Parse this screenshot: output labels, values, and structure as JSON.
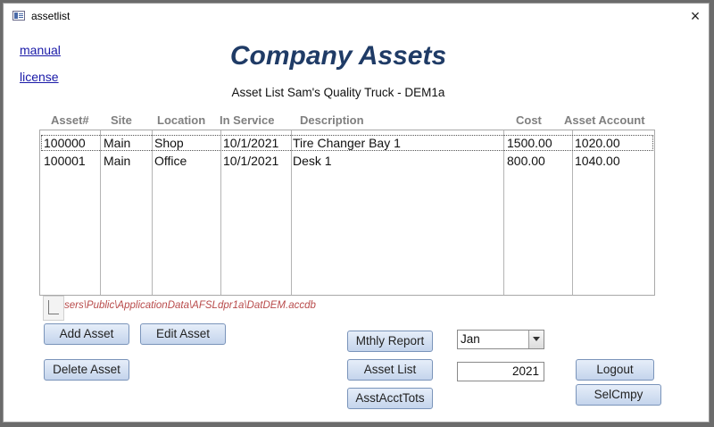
{
  "window": {
    "title": "assetlist",
    "close_glyph": "×"
  },
  "links": {
    "manual": "manual",
    "license": "license"
  },
  "header": {
    "title": "Company Assets",
    "subtitle": "Asset List Sam's Quality Truck - DEM1a"
  },
  "table": {
    "columns": [
      "Asset#",
      "Site",
      "Location",
      "In Service",
      "Description",
      "Cost",
      "Asset Account"
    ],
    "rows": [
      {
        "asset": "100000",
        "site": "Main",
        "location": "Shop",
        "in_service": "10/1/2021",
        "description": "Tire Changer Bay 1",
        "cost": "1500.00",
        "account": "1020.00",
        "selected": true
      },
      {
        "asset": "100001",
        "site": "Main",
        "location": "Office",
        "in_service": "10/1/2021",
        "description": "Desk 1",
        "cost": "800.00",
        "account": "1040.00",
        "selected": false
      }
    ]
  },
  "db_path": "C:\\Users\\Public\\ApplicationData\\AFSLdpr1a\\DatDEM.accdb",
  "buttons": {
    "add_asset": "Add Asset",
    "edit_asset": "Edit Asset",
    "delete_asset": "Delete Asset",
    "monthly_report": "Mthly Report",
    "asset_list": "Asset List",
    "asset_acct_tots": "AsstAcctTots",
    "logout": "Logout",
    "sel_cmpy": "SelCmpy"
  },
  "month_select": {
    "value": "Jan"
  },
  "year_field": {
    "value": "2021"
  },
  "colors": {
    "title": "#1f3b66",
    "link": "#1a1aa8",
    "path": "#b84a4a",
    "header_text": "#7f7f7f"
  },
  "icons": {
    "app": "form-icon",
    "close": "close-icon",
    "dropdown": "chevron-down-icon",
    "tag": "smart-tag-icon"
  }
}
